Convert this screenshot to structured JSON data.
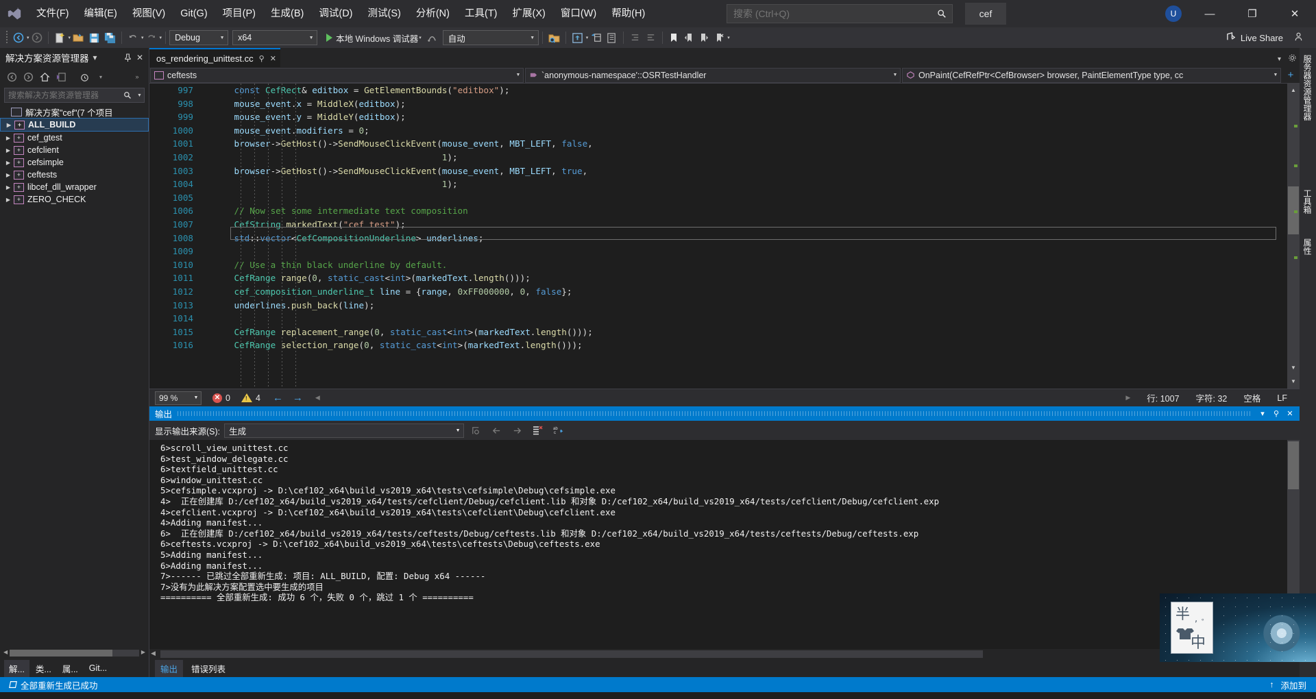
{
  "titlebar": {
    "menus": [
      "文件(F)",
      "编辑(E)",
      "视图(V)",
      "Git(G)",
      "项目(P)",
      "生成(B)",
      "调试(D)",
      "测试(S)",
      "分析(N)",
      "工具(T)",
      "扩展(X)",
      "窗口(W)",
      "帮助(H)"
    ],
    "search_placeholder": "搜索 (Ctrl+Q)",
    "search_value": "",
    "solution_chip": "cef",
    "account_initial": "U",
    "minimize": "—",
    "restore": "❐",
    "close": "✕"
  },
  "toolbar": {
    "configuration": "Debug",
    "platform": "x64",
    "run_label": "本地 Windows 调试器",
    "auto_label": "自动",
    "live_share": "Live Share"
  },
  "sidebar": {
    "title": "解决方案资源管理器",
    "search_placeholder": "搜索解决方案资源管理器",
    "solution_label": "解决方案\"cef\"(7 个项目",
    "items": [
      {
        "label": "ALL_BUILD",
        "selected": true
      },
      {
        "label": "cef_gtest",
        "selected": false
      },
      {
        "label": "cefclient",
        "selected": false
      },
      {
        "label": "cefsimple",
        "selected": false
      },
      {
        "label": "ceftests",
        "selected": false
      },
      {
        "label": "libcef_dll_wrapper",
        "selected": false
      },
      {
        "label": "ZERO_CHECK",
        "selected": false
      }
    ],
    "tabs": [
      {
        "label": "解...",
        "active": true
      },
      {
        "label": "类...",
        "active": false
      },
      {
        "label": "属...",
        "active": false
      },
      {
        "label": "Git...",
        "active": false
      }
    ]
  },
  "editor": {
    "tab_title": "os_rendering_unittest.cc",
    "nav": {
      "project": "ceftests",
      "namespace": "`anonymous-namespace'::OSRTestHandler",
      "member": "OnPaint(CefRefPtr<CefBrowser> browser, PaintElementType type, cc"
    },
    "first_visible_line": 996,
    "lines": [
      {
        "n": 997,
        "text": "      const CefRect& editbox = GetElementBounds(\"editbox\");"
      },
      {
        "n": 998,
        "text": "      mouse_event.x = MiddleX(editbox);"
      },
      {
        "n": 999,
        "text": "      mouse_event.y = MiddleY(editbox);"
      },
      {
        "n": 1000,
        "text": "      mouse_event.modifiers = 0;"
      },
      {
        "n": 1001,
        "text": "      browser->GetHost()->SendMouseClickEvent(mouse_event, MBT_LEFT, false,"
      },
      {
        "n": 1002,
        "text": "                                              1);"
      },
      {
        "n": 1003,
        "text": "      browser->GetHost()->SendMouseClickEvent(mouse_event, MBT_LEFT, true,"
      },
      {
        "n": 1004,
        "text": "                                              1);"
      },
      {
        "n": 1005,
        "text": ""
      },
      {
        "n": 1006,
        "text": "      // Now set some intermediate text composition"
      },
      {
        "n": 1007,
        "text": "      CefString markedText(\"cef test\");"
      },
      {
        "n": 1008,
        "text": "      std::vector<CefCompositionUnderline> underlines;"
      },
      {
        "n": 1009,
        "text": ""
      },
      {
        "n": 1010,
        "text": "      // Use a thin black underline by default."
      },
      {
        "n": 1011,
        "text": "      CefRange range(0, static_cast<int>(markedText.length()));"
      },
      {
        "n": 1012,
        "text": "      cef_composition_underline_t line = {range, 0xFF000000, 0, false};"
      },
      {
        "n": 1013,
        "text": "      underlines.push_back(line);"
      },
      {
        "n": 1014,
        "text": ""
      },
      {
        "n": 1015,
        "text": "      CefRange replacement_range(0, static_cast<int>(markedText.length()));"
      },
      {
        "n": 1016,
        "text": "      CefRange selection_range(0, static_cast<int>(markedText.length()));"
      }
    ],
    "status": {
      "zoom": "99 %",
      "error_count": "0",
      "warning_count": "4",
      "line": "行: 1007",
      "char": "字符: 32",
      "spaces": "空格",
      "eol": "LF"
    }
  },
  "output": {
    "title": "输出",
    "source_label": "显示输出来源(S):",
    "source_value": "生成",
    "lines": [
      "6>scroll_view_unittest.cc",
      "6>test_window_delegate.cc",
      "6>textfield_unittest.cc",
      "6>window_unittest.cc",
      "5>cefsimple.vcxproj -> D:\\cef102_x64\\build_vs2019_x64\\tests\\cefsimple\\Debug\\cefsimple.exe",
      "4>  正在创建库 D:/cef102_x64/build_vs2019_x64/tests/cefclient/Debug/cefclient.lib 和对象 D:/cef102_x64/build_vs2019_x64/tests/cefclient/Debug/cefclient.exp",
      "4>cefclient.vcxproj -> D:\\cef102_x64\\build_vs2019_x64\\tests\\cefclient\\Debug\\cefclient.exe",
      "4>Adding manifest...",
      "6>  正在创建库 D:/cef102_x64/build_vs2019_x64/tests/ceftests/Debug/ceftests.lib 和对象 D:/cef102_x64/build_vs2019_x64/tests/ceftests/Debug/ceftests.exp",
      "6>ceftests.vcxproj -> D:\\cef102_x64\\build_vs2019_x64\\tests\\ceftests\\Debug\\ceftests.exe",
      "5>Adding manifest...",
      "6>Adding manifest...",
      "7>------ 已跳过全部重新生成: 项目: ALL_BUILD, 配置: Debug x64 ------",
      "7>没有为此解决方案配置选中要生成的项目",
      "========== 全部重新生成: 成功 6 个，失败 0 个，跳过 1 个 =========="
    ],
    "tabs": [
      {
        "label": "输出",
        "active": true
      },
      {
        "label": "错误列表",
        "active": false
      }
    ]
  },
  "right_strips": [
    {
      "label": "服务器资源管理器"
    },
    {
      "label": "工具箱"
    },
    {
      "label": "属性"
    }
  ],
  "statusbar": {
    "message": "全部重新生成已成功",
    "right_label": "添加到"
  },
  "overlay": {
    "ime_text": "半,。中"
  },
  "colors": {
    "accent": "#007acc",
    "titlebar_bg": "#2d2d30",
    "editor_bg": "#1e1e1e",
    "sidebar_bg": "#252526"
  }
}
